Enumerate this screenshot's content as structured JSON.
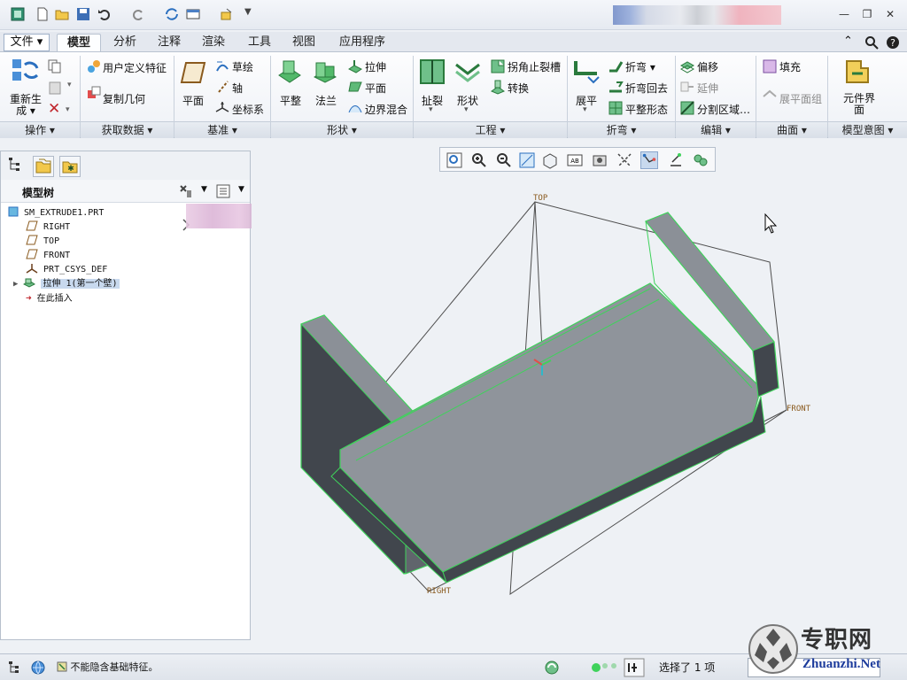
{
  "colors": {
    "accent": "#2a6fbf",
    "model_green": "#3fd25b",
    "model_body": "#8b9097",
    "model_dark": "#41464d"
  },
  "menu": {
    "file": "文件",
    "tabs": [
      "模型",
      "分析",
      "注释",
      "渲染",
      "工具",
      "视图",
      "应用程序"
    ]
  },
  "ribbon": {
    "regenerate": "重新生成",
    "user_defined_feature": "用户定义特征",
    "copy_geometry": "复制几何",
    "plane": "平面",
    "sketch": "草绘",
    "axis": "轴",
    "csys": "坐标系",
    "flat": "平整",
    "flange": "法兰",
    "extrude": "拉伸",
    "planar": "平面",
    "boundary_blend": "边界混合",
    "rip": "扯裂",
    "form": "形状",
    "corner_relief": "拐角止裂槽",
    "convert": "转换",
    "unbend": "展平",
    "bend": "折弯",
    "bend_back": "折弯回去",
    "flat_state": "平整形态",
    "offset": "偏移",
    "extend": "延伸",
    "split_area": "分割区域…",
    "fill": "填充",
    "flatten_quilt": "展平面组",
    "component_interface": "元件界面",
    "groups": [
      "操作",
      "获取数据",
      "基准",
      "形状",
      "工程",
      "折弯",
      "编辑",
      "曲面",
      "模型意图"
    ]
  },
  "model_tree": {
    "title": "模型树",
    "items": [
      {
        "label": "SM_EXTRUDE1.PRT",
        "icon": "part-icon"
      },
      {
        "label": "RIGHT",
        "icon": "datum-plane-icon"
      },
      {
        "label": "TOP",
        "icon": "datum-plane-icon"
      },
      {
        "label": "FRONT",
        "icon": "datum-plane-icon"
      },
      {
        "label": "PRT_CSYS_DEF",
        "icon": "csys-icon"
      },
      {
        "label": "拉伸 1(第一个壁)",
        "icon": "extrude-feature-icon"
      },
      {
        "label": "在此插入",
        "icon": "insert-arrow-icon"
      }
    ]
  },
  "viewport": {
    "datum_labels": {
      "top": "TOP",
      "front": "FRONT",
      "right": "RIGHT"
    }
  },
  "status": {
    "message": "不能隐含基础特征。",
    "selection": "选择了 1 项"
  },
  "watermark": {
    "text": "专职网",
    "url_text": "Zhuanzhi.Net"
  }
}
